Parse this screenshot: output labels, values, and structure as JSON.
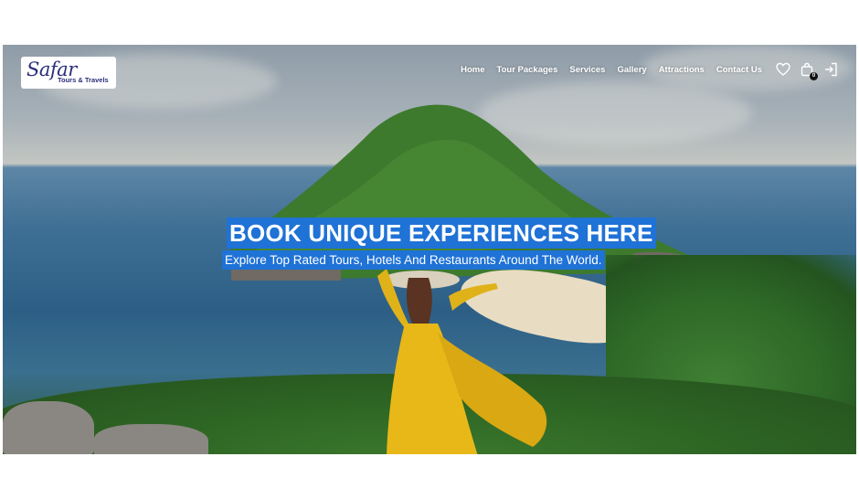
{
  "brand": {
    "logo_main": "Safar",
    "logo_sub": "Tours & Travels"
  },
  "nav": {
    "items": [
      {
        "label": "Home"
      },
      {
        "label": "Tour Packages"
      },
      {
        "label": "Services"
      },
      {
        "label": "Gallery"
      },
      {
        "label": "Attractions"
      },
      {
        "label": "Contact Us"
      }
    ]
  },
  "header_icons": {
    "wishlist": "heart-icon",
    "cart": "shopping-bag-icon",
    "cart_count": "0",
    "login": "login-icon"
  },
  "hero": {
    "title": "BOOK UNIQUE EXPERIENCES HERE",
    "subtitle": "Explore Top Rated Tours, Hotels And Restaurants Around The World."
  },
  "colors": {
    "highlight": "#1f72d6",
    "logo_text": "#2b2f7a",
    "logo_accent": "#c0262b"
  }
}
